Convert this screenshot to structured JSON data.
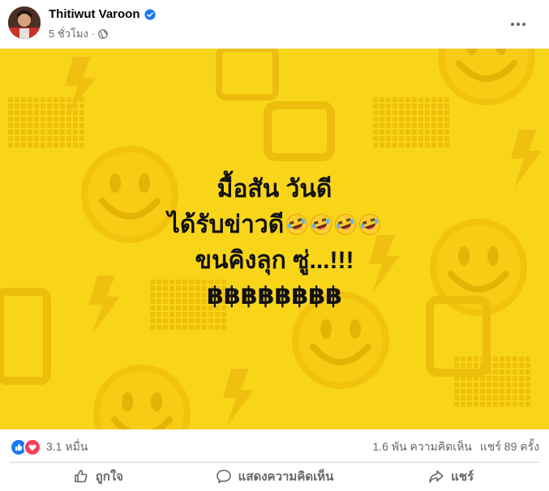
{
  "post": {
    "author": "Thitiwut Varoon",
    "time": "5 ชั่วโมง",
    "audience_icon": "globe-icon",
    "verified_icon": "verified-badge-icon",
    "image": {
      "background_color": "#f9d51a",
      "pattern": [
        "smiley-icon",
        "lightning-icon",
        "pixel-grid-icon"
      ],
      "lines": [
        "มื้อสัน วันดี",
        "ได้รับข่าวดี",
        "ขนคิงลุก ซู่...!!!",
        "฿฿฿฿฿฿฿฿"
      ],
      "emoji": [
        "rolling-laughing-emoji",
        "rolling-laughing-emoji",
        "rolling-laughing-emoji",
        "rolling-laughing-emoji"
      ]
    }
  },
  "stats": {
    "reactions": [
      "like-icon",
      "love-icon"
    ],
    "reaction_count": "3.1 หมื่น",
    "comments": "1.6 พัน ความคิดเห็น",
    "shares": "แชร์ 89 ครั้ง"
  },
  "actions": {
    "like": "ถูกใจ",
    "comment": "แสดงความคิดเห็น",
    "share": "แชร์"
  },
  "colors": {
    "accent": "#1877f2",
    "love": "#f33e58",
    "muted": "#65676b"
  }
}
